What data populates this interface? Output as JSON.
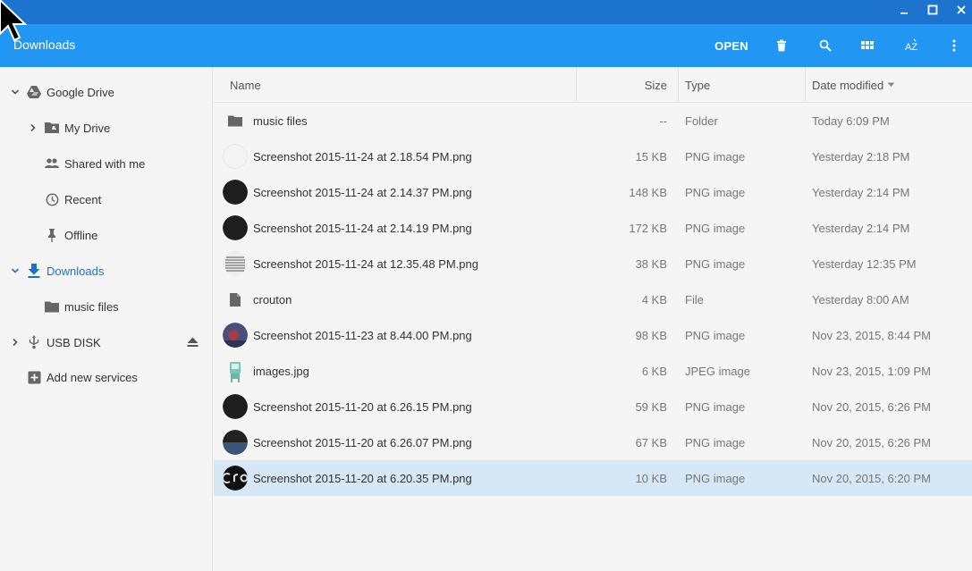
{
  "window": {
    "title": "Downloads",
    "controls": {
      "minimize_icon": "minimize-icon",
      "maximize_icon": "maximize-icon",
      "close_icon": "close-icon"
    }
  },
  "toolbar": {
    "open_label": "OPEN",
    "icons": [
      "trash-icon",
      "search-icon",
      "grid-view-icon",
      "sort-az-icon",
      "more-vert-icon"
    ],
    "sort_label": "AZ"
  },
  "sidebar": {
    "items": [
      {
        "label": "Google Drive",
        "icon": "google-drive-icon",
        "expandable": "expanded"
      },
      {
        "label": "My Drive",
        "icon": "folder-drive-icon",
        "expandable": "collapsed"
      },
      {
        "label": "Shared with me",
        "icon": "people-icon"
      },
      {
        "label": "Recent",
        "icon": "clock-icon"
      },
      {
        "label": "Offline",
        "icon": "pin-icon"
      },
      {
        "label": "Downloads",
        "icon": "download-icon",
        "expandable": "expanded",
        "active": true
      },
      {
        "label": "music files",
        "icon": "folder-icon"
      },
      {
        "label": "USB DISK",
        "icon": "usb-icon",
        "expandable": "collapsed",
        "eject": true
      },
      {
        "label": "Add new services",
        "icon": "add-box-icon"
      }
    ]
  },
  "columns": {
    "name": "Name",
    "size": "Size",
    "type": "Type",
    "date": "Date modified",
    "sort_icon": "sort-desc-icon"
  },
  "files": [
    {
      "name": "music files",
      "size": "--",
      "type": "Folder",
      "date": "Today 6:09 PM",
      "icon": "folder-icon"
    },
    {
      "name": "Screenshot 2015-11-24 at 2.18.54 PM.png",
      "size": "15 KB",
      "type": "PNG image",
      "date": "Yesterday 2:18 PM",
      "icon": "thumb-light"
    },
    {
      "name": "Screenshot 2015-11-24 at 2.14.37 PM.png",
      "size": "148 KB",
      "type": "PNG image",
      "date": "Yesterday 2:14 PM",
      "icon": "thumb-dark"
    },
    {
      "name": "Screenshot 2015-11-24 at 2.14.19 PM.png",
      "size": "172 KB",
      "type": "PNG image",
      "date": "Yesterday 2:14 PM",
      "icon": "thumb-dark"
    },
    {
      "name": "Screenshot 2015-11-24 at 12.35.48 PM.png",
      "size": "38 KB",
      "type": "PNG image",
      "date": "Yesterday 12:35 PM",
      "icon": "thumb-text"
    },
    {
      "name": "crouton",
      "size": "4 KB",
      "type": "File",
      "date": "Yesterday 8:00 AM",
      "icon": "file-icon"
    },
    {
      "name": "Screenshot 2015-11-23 at 8.44.00 PM.png",
      "size": "98 KB",
      "type": "PNG image",
      "date": "Nov 23, 2015, 8:44 PM",
      "icon": "thumb-photo"
    },
    {
      "name": "images.jpg",
      "size": "6 KB",
      "type": "JPEG image",
      "date": "Nov 23, 2015, 1:09 PM",
      "icon": "thumb-robot"
    },
    {
      "name": "Screenshot 2015-11-20 at 6.26.15 PM.png",
      "size": "59 KB",
      "type": "PNG image",
      "date": "Nov 20, 2015, 6:26 PM",
      "icon": "thumb-dark"
    },
    {
      "name": "Screenshot 2015-11-20 at 6.26.07 PM.png",
      "size": "67 KB",
      "type": "PNG image",
      "date": "Nov 20, 2015, 6:26 PM",
      "icon": "thumb-horizon"
    },
    {
      "name": "Screenshot 2015-11-20 at 6.20.35 PM.png",
      "size": "10 KB",
      "type": "PNG image",
      "date": "Nov 20, 2015, 6:20 PM",
      "icon": "thumb-cro",
      "selected": true
    }
  ],
  "colors": {
    "titlebar": "#1c74cf",
    "toolbar": "#2196f3",
    "accent": "#1a73c8",
    "selected_row": "#d6e8f5"
  }
}
